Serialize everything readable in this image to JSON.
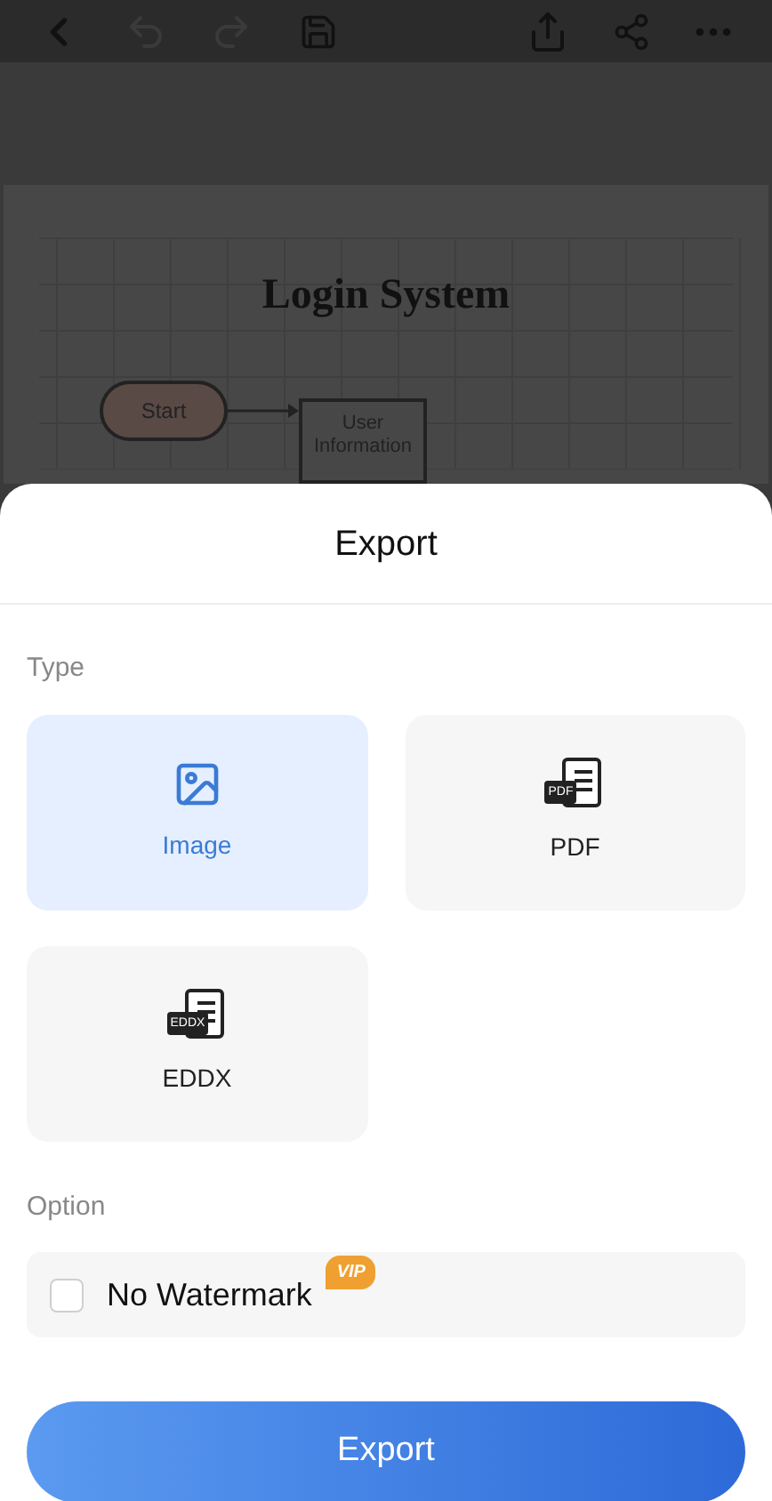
{
  "diagram": {
    "title": "Login System",
    "nodes": [
      {
        "kind": "terminal",
        "label": "Start"
      },
      {
        "kind": "process",
        "label": "User Information"
      }
    ]
  },
  "sheet": {
    "title": "Export",
    "type_label": "Type",
    "types": [
      {
        "kind": "image",
        "label": "Image",
        "selected": true
      },
      {
        "kind": "pdf",
        "label": "PDF",
        "badge": "PDF",
        "selected": false
      },
      {
        "kind": "eddx",
        "label": "EDDX",
        "badge": "EDDX",
        "selected": false
      }
    ],
    "option_label": "Option",
    "options": [
      {
        "label": "No Watermark",
        "badge": "VIP",
        "checked": false
      }
    ],
    "button": "Export"
  }
}
